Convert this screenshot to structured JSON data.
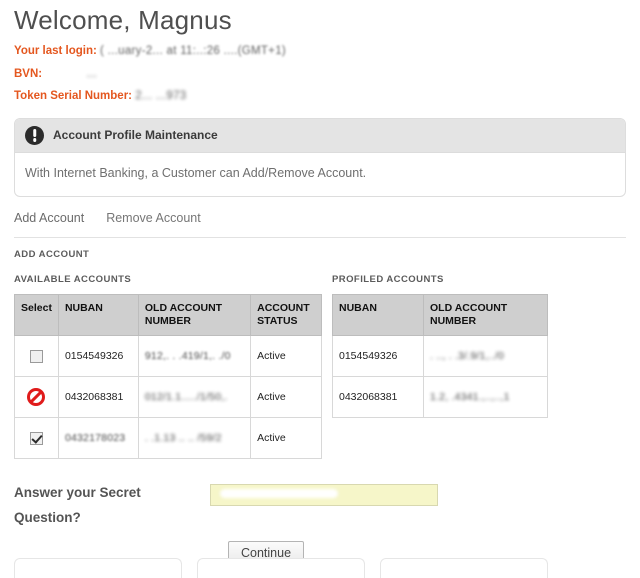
{
  "header": {
    "welcome_title": "Welcome, Magnus",
    "last_login_label": "Your last login:",
    "last_login_value": "( ...uary-2... at 11:..:26 ....(GMT+1)",
    "bvn_label": "BVN:",
    "bvn_value": "...",
    "token_serial_label": "Token Serial Number:",
    "token_serial_value": "2...   ...973"
  },
  "info_panel": {
    "icon": "info-badge-icon",
    "title": "Account Profile Maintenance",
    "body": "With Internet Banking, a Customer can Add/Remove Account."
  },
  "tabs": [
    {
      "label": "Add Account",
      "active": true
    },
    {
      "label": "Remove Account",
      "active": false
    }
  ],
  "section": {
    "label": "ADD ACCOUNT"
  },
  "available_accounts": {
    "caption": "AVAILABLE ACCOUNTS",
    "columns": [
      "Select",
      "NUBAN",
      "OLD ACCOUNT NUMBER",
      "ACCOUNT STATUS"
    ],
    "rows": [
      {
        "select_control": "checkbox",
        "checked": false,
        "nuban": "0154549326",
        "old_account_number": "912,. . .419/1,. ./0",
        "status": "Active"
      },
      {
        "select_control": "no-entry",
        "checked": false,
        "nuban": "0432068381",
        "old_account_number": "012/1.1...../1/50,.",
        "status": "Active"
      },
      {
        "select_control": "checkbox",
        "checked": true,
        "nuban": "0432178023",
        "old_account_number": ". .1.13 .. .. /59/2",
        "status": "Active"
      }
    ]
  },
  "profiled_accounts": {
    "caption": "PROFILED ACCOUNTS",
    "columns": [
      "NUBAN",
      "OLD ACCOUNT NUMBER"
    ],
    "rows": [
      {
        "nuban": "0154549326",
        "old_account_number": ". .., . .3/.9/1,../0"
      },
      {
        "nuban": "0432068381",
        "old_account_number": "1.2, .4341.,..,..,1"
      }
    ]
  },
  "secret_question": {
    "label": "Answer your Secret Question?",
    "value": "",
    "placeholder": ""
  },
  "actions": {
    "continue_label": "Continue"
  },
  "colors": {
    "accent": "#e4571f",
    "table_header_bg": "#cfcfcf",
    "panel_header_bg": "#e4e4e4",
    "input_highlight": "#f6f6c9",
    "no_entry_red": "#e01b1b"
  }
}
